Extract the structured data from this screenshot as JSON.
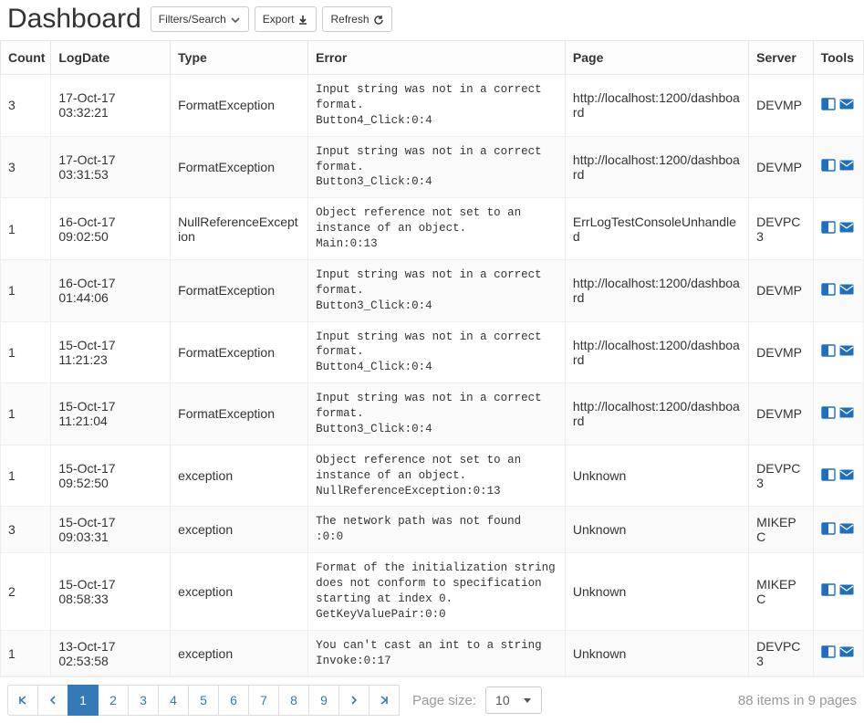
{
  "header": {
    "title": "Dashboard",
    "filters_label": "Filters/Search",
    "export_label": "Export",
    "refresh_label": "Refresh"
  },
  "columns": {
    "count": "Count",
    "logdate": "LogDate",
    "type": "Type",
    "error": "Error",
    "page": "Page",
    "server": "Server",
    "tools": "Tools"
  },
  "rows": [
    {
      "count": "3",
      "logdate": "17-Oct-17 03:32:21",
      "type": "FormatException",
      "error": "Input string was not in a correct format.\nButton4_Click:0:4",
      "page": "http://localhost:1200/dashboard",
      "server": "DEVMP"
    },
    {
      "count": "3",
      "logdate": "17-Oct-17 03:31:53",
      "type": "FormatException",
      "error": "Input string was not in a correct format.\nButton3_Click:0:4",
      "page": "http://localhost:1200/dashboard",
      "server": "DEVMP"
    },
    {
      "count": "1",
      "logdate": "16-Oct-17 09:02:50",
      "type": "NullReferenceException",
      "error": "Object reference not set to an instance of an object.\nMain:0:13",
      "page": "ErrLogTestConsoleUnhandled",
      "server": "DEVPC3"
    },
    {
      "count": "1",
      "logdate": "16-Oct-17 01:44:06",
      "type": "FormatException",
      "error": "Input string was not in a correct format.\nButton3_Click:0:4",
      "page": "http://localhost:1200/dashboard",
      "server": "DEVMP"
    },
    {
      "count": "1",
      "logdate": "15-Oct-17 11:21:23",
      "type": "FormatException",
      "error": "Input string was not in a correct format.\nButton4_Click:0:4",
      "page": "http://localhost:1200/dashboard",
      "server": "DEVMP"
    },
    {
      "count": "1",
      "logdate": "15-Oct-17 11:21:04",
      "type": "FormatException",
      "error": "Input string was not in a correct format.\nButton3_Click:0:4",
      "page": "http://localhost:1200/dashboard",
      "server": "DEVMP"
    },
    {
      "count": "1",
      "logdate": "15-Oct-17 09:52:50",
      "type": "exception",
      "error": "Object reference not set to an instance of an object.\nNullReferenceException:0:13",
      "page": "Unknown",
      "server": "DEVPC3"
    },
    {
      "count": "3",
      "logdate": "15-Oct-17 09:03:31",
      "type": "exception",
      "error": "The network path was not found\n:0:0",
      "page": "Unknown",
      "server": "MIKEPC"
    },
    {
      "count": "2",
      "logdate": "15-Oct-17 08:58:33",
      "type": "exception",
      "error": "Format of the initialization string does not conform to specification starting at index 0.\nGetKeyValuePair:0:0",
      "page": "Unknown",
      "server": "MIKEPC"
    },
    {
      "count": "1",
      "logdate": "13-Oct-17 02:53:58",
      "type": "exception",
      "error": "You can't cast an int to a string\nInvoke:0:17",
      "page": "Unknown",
      "server": "DEVPC3"
    }
  ],
  "pager": {
    "pages": [
      "1",
      "2",
      "3",
      "4",
      "5",
      "6",
      "7",
      "8",
      "9"
    ],
    "active": "1",
    "page_size_label": "Page size:",
    "page_size_value": "10",
    "summary": "88 items in 9 pages"
  }
}
